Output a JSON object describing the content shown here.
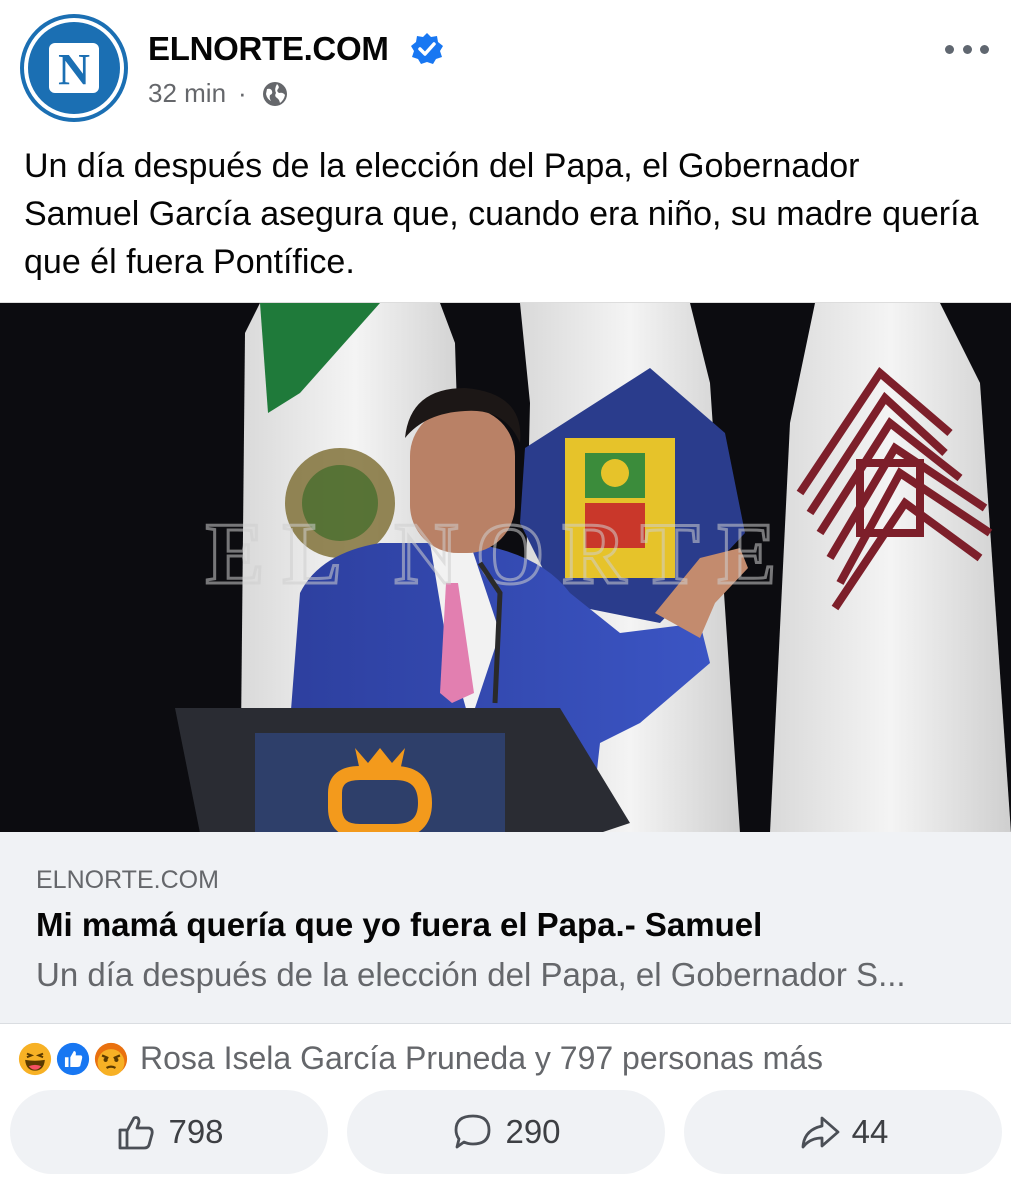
{
  "post": {
    "page_name": "ELNORTE.COM",
    "avatar_letter": "N",
    "time": "32 min",
    "separator": "·",
    "privacy_icon": "globe-icon",
    "more_icon": "more-dots-icon",
    "caption": "Un día después de la elección del Papa, el Gobernador Samuel García asegura que, cuando era niño, su madre quería que él fuera Pontífice."
  },
  "photo": {
    "watermark": "EL NORTE"
  },
  "link": {
    "domain": "ELNORTE.COM",
    "title": "Mi mamá quería que yo fuera el Papa.- Samuel",
    "description": "Un día después de la elección del Papa, el Gobernador S..."
  },
  "reactions": {
    "icons": [
      "haha-icon",
      "like-icon",
      "angry-icon"
    ],
    "summary": "Rosa Isela García Pruneda y 797 personas más"
  },
  "actions": {
    "like_count": "798",
    "comment_count": "290",
    "share_count": "44"
  },
  "colors": {
    "brand_blue": "#1b6fb3",
    "verified_blue": "#1877f2",
    "like_blue": "#1877f2",
    "haha_yellow": "#f7b125",
    "angry_red": "#e9710f"
  }
}
